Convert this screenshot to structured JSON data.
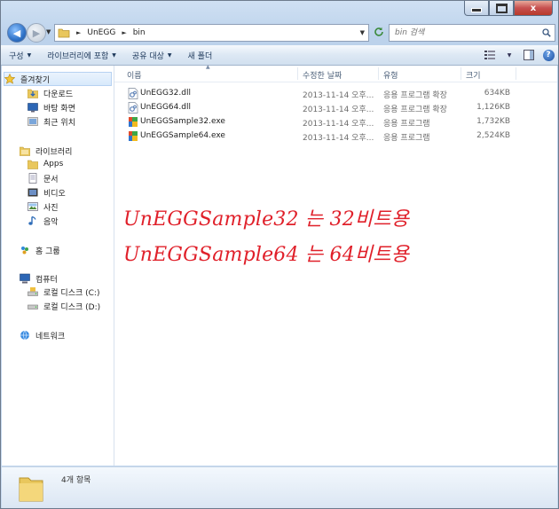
{
  "window": {
    "close_label": "x"
  },
  "address": {
    "segments": [
      "UnEGG",
      "bin"
    ]
  },
  "search": {
    "placeholder": "bin 검색"
  },
  "toolbar": {
    "organize": "구성",
    "include_library": "라이브러리에 포함",
    "share": "공유 대상",
    "new_folder": "새 폴더"
  },
  "nav": {
    "favorites": "즐겨찾기",
    "downloads": "다운로드",
    "desktop": "바탕 화면",
    "recent": "최근 위치",
    "libraries": "라이브러리",
    "apps": "Apps",
    "documents": "문서",
    "videos": "비디오",
    "pictures": "사진",
    "music": "음악",
    "homegroup": "홈 그룹",
    "computer": "컴퓨터",
    "drive_c": "로컬 디스크 (C:)",
    "drive_d": "로컬 디스크 (D:)",
    "network": "네트워크"
  },
  "columns": {
    "name": "이름",
    "modified": "수정한 날짜",
    "type": "유형",
    "size": "크기"
  },
  "files": [
    {
      "name": "UnEGG32.dll",
      "modified": "2013-11-14 오후...",
      "type": "응용 프로그램 확장",
      "size": "634KB",
      "icon": "dll-icon"
    },
    {
      "name": "UnEGG64.dll",
      "modified": "2013-11-14 오후...",
      "type": "응용 프로그램 확장",
      "size": "1,126KB",
      "icon": "dll-icon"
    },
    {
      "name": "UnEGGSample32.exe",
      "modified": "2013-11-14 오후...",
      "type": "응용 프로그램",
      "size": "1,732KB",
      "icon": "exe-icon"
    },
    {
      "name": "UnEGGSample64.exe",
      "modified": "2013-11-14 오후...",
      "type": "응용 프로그램",
      "size": "2,524KB",
      "icon": "exe-icon"
    }
  ],
  "annotations": {
    "line1": "UnEGGSample32 는 32비트용",
    "line2": "UnEGGSample64 는 64비트용"
  },
  "details": {
    "item_count": "4개 항목"
  },
  "colors": {
    "annotation": "#e0202a",
    "accent": "#2f73c8"
  }
}
